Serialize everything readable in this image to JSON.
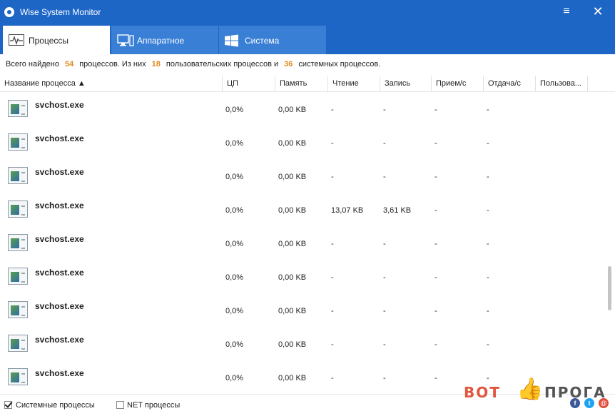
{
  "window": {
    "title": "Wise System Monitor"
  },
  "tabs": [
    {
      "label": "Процессы"
    },
    {
      "label": "Аппаратное"
    },
    {
      "label": "Система"
    }
  ],
  "summary": {
    "prefix": "Всего найдено",
    "total": "54",
    "mid1": "процессов. Из них",
    "user": "18",
    "mid2": "пользовательских процессов и",
    "system": "36",
    "suffix": "системных процессов."
  },
  "columns": [
    "Название процесса ▲",
    "ЦП",
    "Память",
    "Чтение",
    "Запись",
    "Прием/с",
    "Отдача/с",
    "Пользова..."
  ],
  "rows": [
    {
      "name": "svchost.exe",
      "cpu": "0,0%",
      "mem": "0,00 KB",
      "read": "-",
      "write": "-",
      "recv": "-",
      "send": "-"
    },
    {
      "name": "svchost.exe",
      "cpu": "0,0%",
      "mem": "0,00 KB",
      "read": "-",
      "write": "-",
      "recv": "-",
      "send": "-"
    },
    {
      "name": "svchost.exe",
      "cpu": "0,0%",
      "mem": "0,00 KB",
      "read": "-",
      "write": "-",
      "recv": "-",
      "send": "-"
    },
    {
      "name": "svchost.exe",
      "cpu": "0,0%",
      "mem": "0,00 KB",
      "read": "13,07 KB",
      "write": "3,61 KB",
      "recv": "-",
      "send": "-"
    },
    {
      "name": "svchost.exe",
      "cpu": "0,0%",
      "mem": "0,00 KB",
      "read": "-",
      "write": "-",
      "recv": "-",
      "send": "-"
    },
    {
      "name": "svchost.exe",
      "cpu": "0,0%",
      "mem": "0,00 KB",
      "read": "-",
      "write": "-",
      "recv": "-",
      "send": "-"
    },
    {
      "name": "svchost.exe",
      "cpu": "0,0%",
      "mem": "0,00 KB",
      "read": "-",
      "write": "-",
      "recv": "-",
      "send": "-"
    },
    {
      "name": "svchost.exe",
      "cpu": "0,0%",
      "mem": "0,00 KB",
      "read": "-",
      "write": "-",
      "recv": "-",
      "send": "-"
    },
    {
      "name": "svchost.exe",
      "cpu": "0,0%",
      "mem": "0,00 KB",
      "read": "-",
      "write": "-",
      "recv": "-",
      "send": "-"
    }
  ],
  "footer": {
    "system_processes_label": "Системные процессы",
    "system_processes_checked": true,
    "net_processes_label": "NET процессы",
    "net_processes_checked": false
  },
  "watermark": {
    "left": "BOT",
    "right": "ПРОГА"
  },
  "colors": {
    "titlebar": "#1e66c6",
    "tab_inactive": "#3a7fd6",
    "accent_number": "#e08a1e"
  }
}
